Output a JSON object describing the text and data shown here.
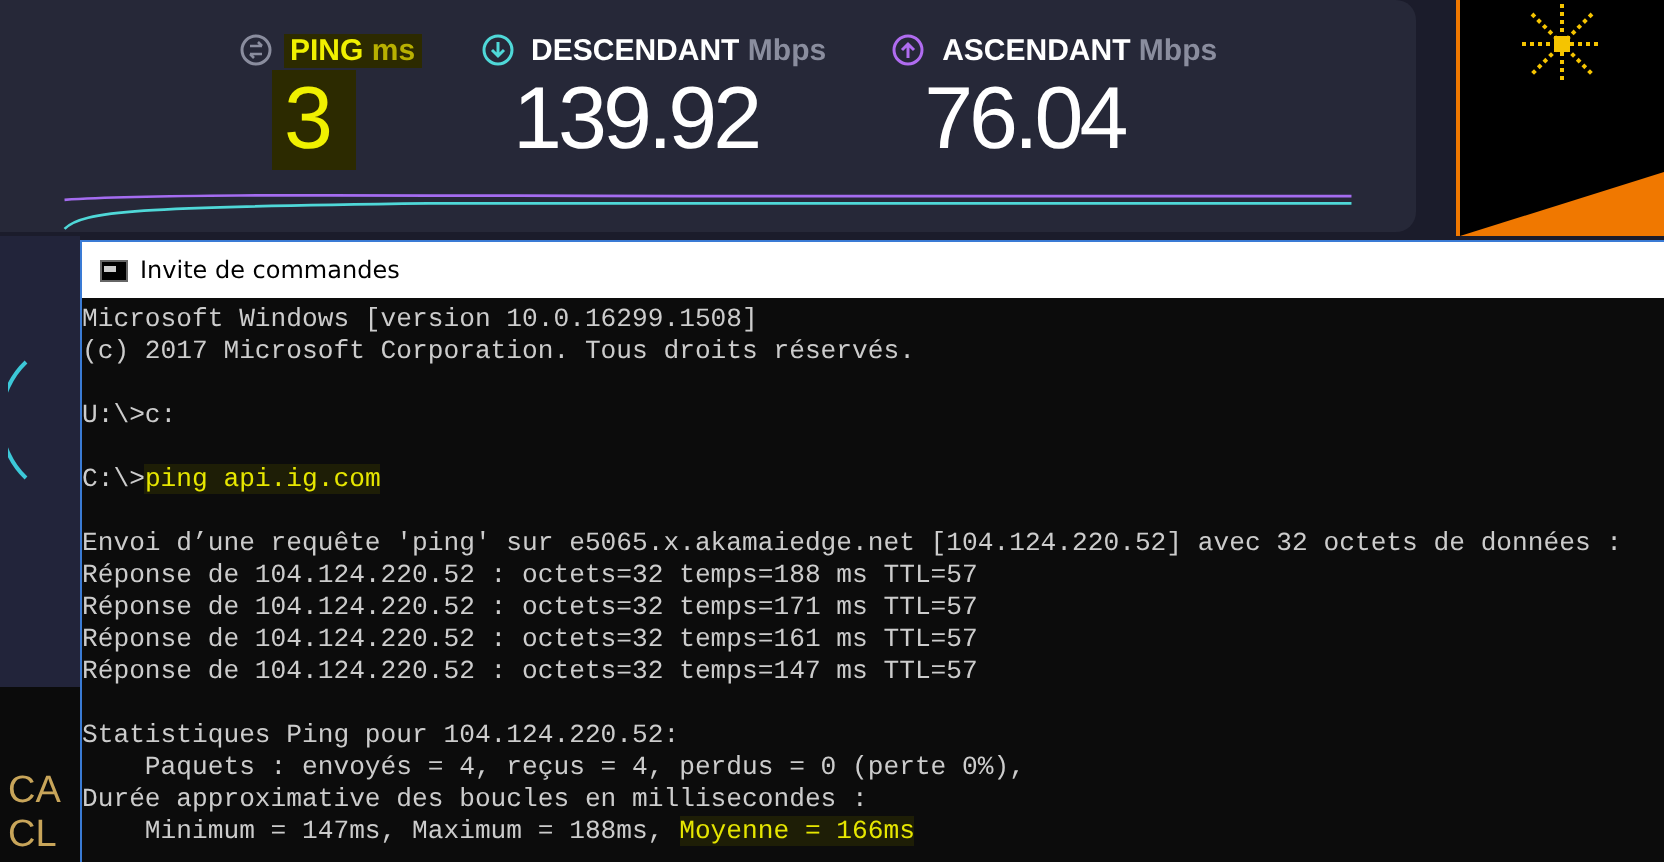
{
  "speedtest": {
    "metrics": [
      {
        "kind": "ping",
        "label": "PING",
        "unit": "ms",
        "value": "3",
        "highlighted": true
      },
      {
        "kind": "download",
        "label": "DESCENDANT",
        "unit": "Mbps",
        "value": "139.92",
        "highlighted": false
      },
      {
        "kind": "upload",
        "label": "ASCENDANT",
        "unit": "Mbps",
        "value": "76.04",
        "highlighted": false
      }
    ]
  },
  "background_text": [
    "CA",
    "CL"
  ],
  "terminal": {
    "title": "Invite de commandes",
    "lines": [
      {
        "kind": "text",
        "segments": [
          {
            "text": "Microsoft Windows [version 10.0.16299.1508]",
            "highlighted": false
          }
        ]
      },
      {
        "kind": "text",
        "segments": [
          {
            "text": "(c) 2017 Microsoft Corporation. Tous droits réservés.",
            "highlighted": false
          }
        ]
      },
      {
        "kind": "blank"
      },
      {
        "kind": "text",
        "segments": [
          {
            "text": "U:\\>c:",
            "highlighted": false
          }
        ]
      },
      {
        "kind": "blank"
      },
      {
        "kind": "text",
        "segments": [
          {
            "text": "C:\\>",
            "highlighted": false
          },
          {
            "text": "ping api.ig.com",
            "highlighted": true
          }
        ]
      },
      {
        "kind": "blank"
      },
      {
        "kind": "text",
        "segments": [
          {
            "text": "Envoi d’une requête 'ping' sur e5065.x.akamaiedge.net [104.124.220.52] avec 32 octets de données :",
            "highlighted": false
          }
        ]
      },
      {
        "kind": "text",
        "segments": [
          {
            "text": "Réponse de 104.124.220.52 : octets=32 temps=188 ms TTL=57",
            "highlighted": false
          }
        ]
      },
      {
        "kind": "text",
        "segments": [
          {
            "text": "Réponse de 104.124.220.52 : octets=32 temps=171 ms TTL=57",
            "highlighted": false
          }
        ]
      },
      {
        "kind": "text",
        "segments": [
          {
            "text": "Réponse de 104.124.220.52 : octets=32 temps=161 ms TTL=57",
            "highlighted": false
          }
        ]
      },
      {
        "kind": "text",
        "segments": [
          {
            "text": "Réponse de 104.124.220.52 : octets=32 temps=147 ms TTL=57",
            "highlighted": false
          }
        ]
      },
      {
        "kind": "blank"
      },
      {
        "kind": "text",
        "segments": [
          {
            "text": "Statistiques Ping pour 104.124.220.52:",
            "highlighted": false
          }
        ]
      },
      {
        "kind": "text",
        "segments": [
          {
            "text": "    Paquets : envoyés = 4, reçus = 4, perdus = 0 (perte 0%),",
            "highlighted": false
          }
        ]
      },
      {
        "kind": "text",
        "segments": [
          {
            "text": "Durée approximative des boucles en millisecondes :",
            "highlighted": false
          }
        ]
      },
      {
        "kind": "text",
        "segments": [
          {
            "text": "    Minimum = 147ms, Maximum = 188ms, ",
            "highlighted": false
          },
          {
            "text": "Moyenne = 166ms",
            "highlighted": true
          }
        ]
      }
    ]
  }
}
